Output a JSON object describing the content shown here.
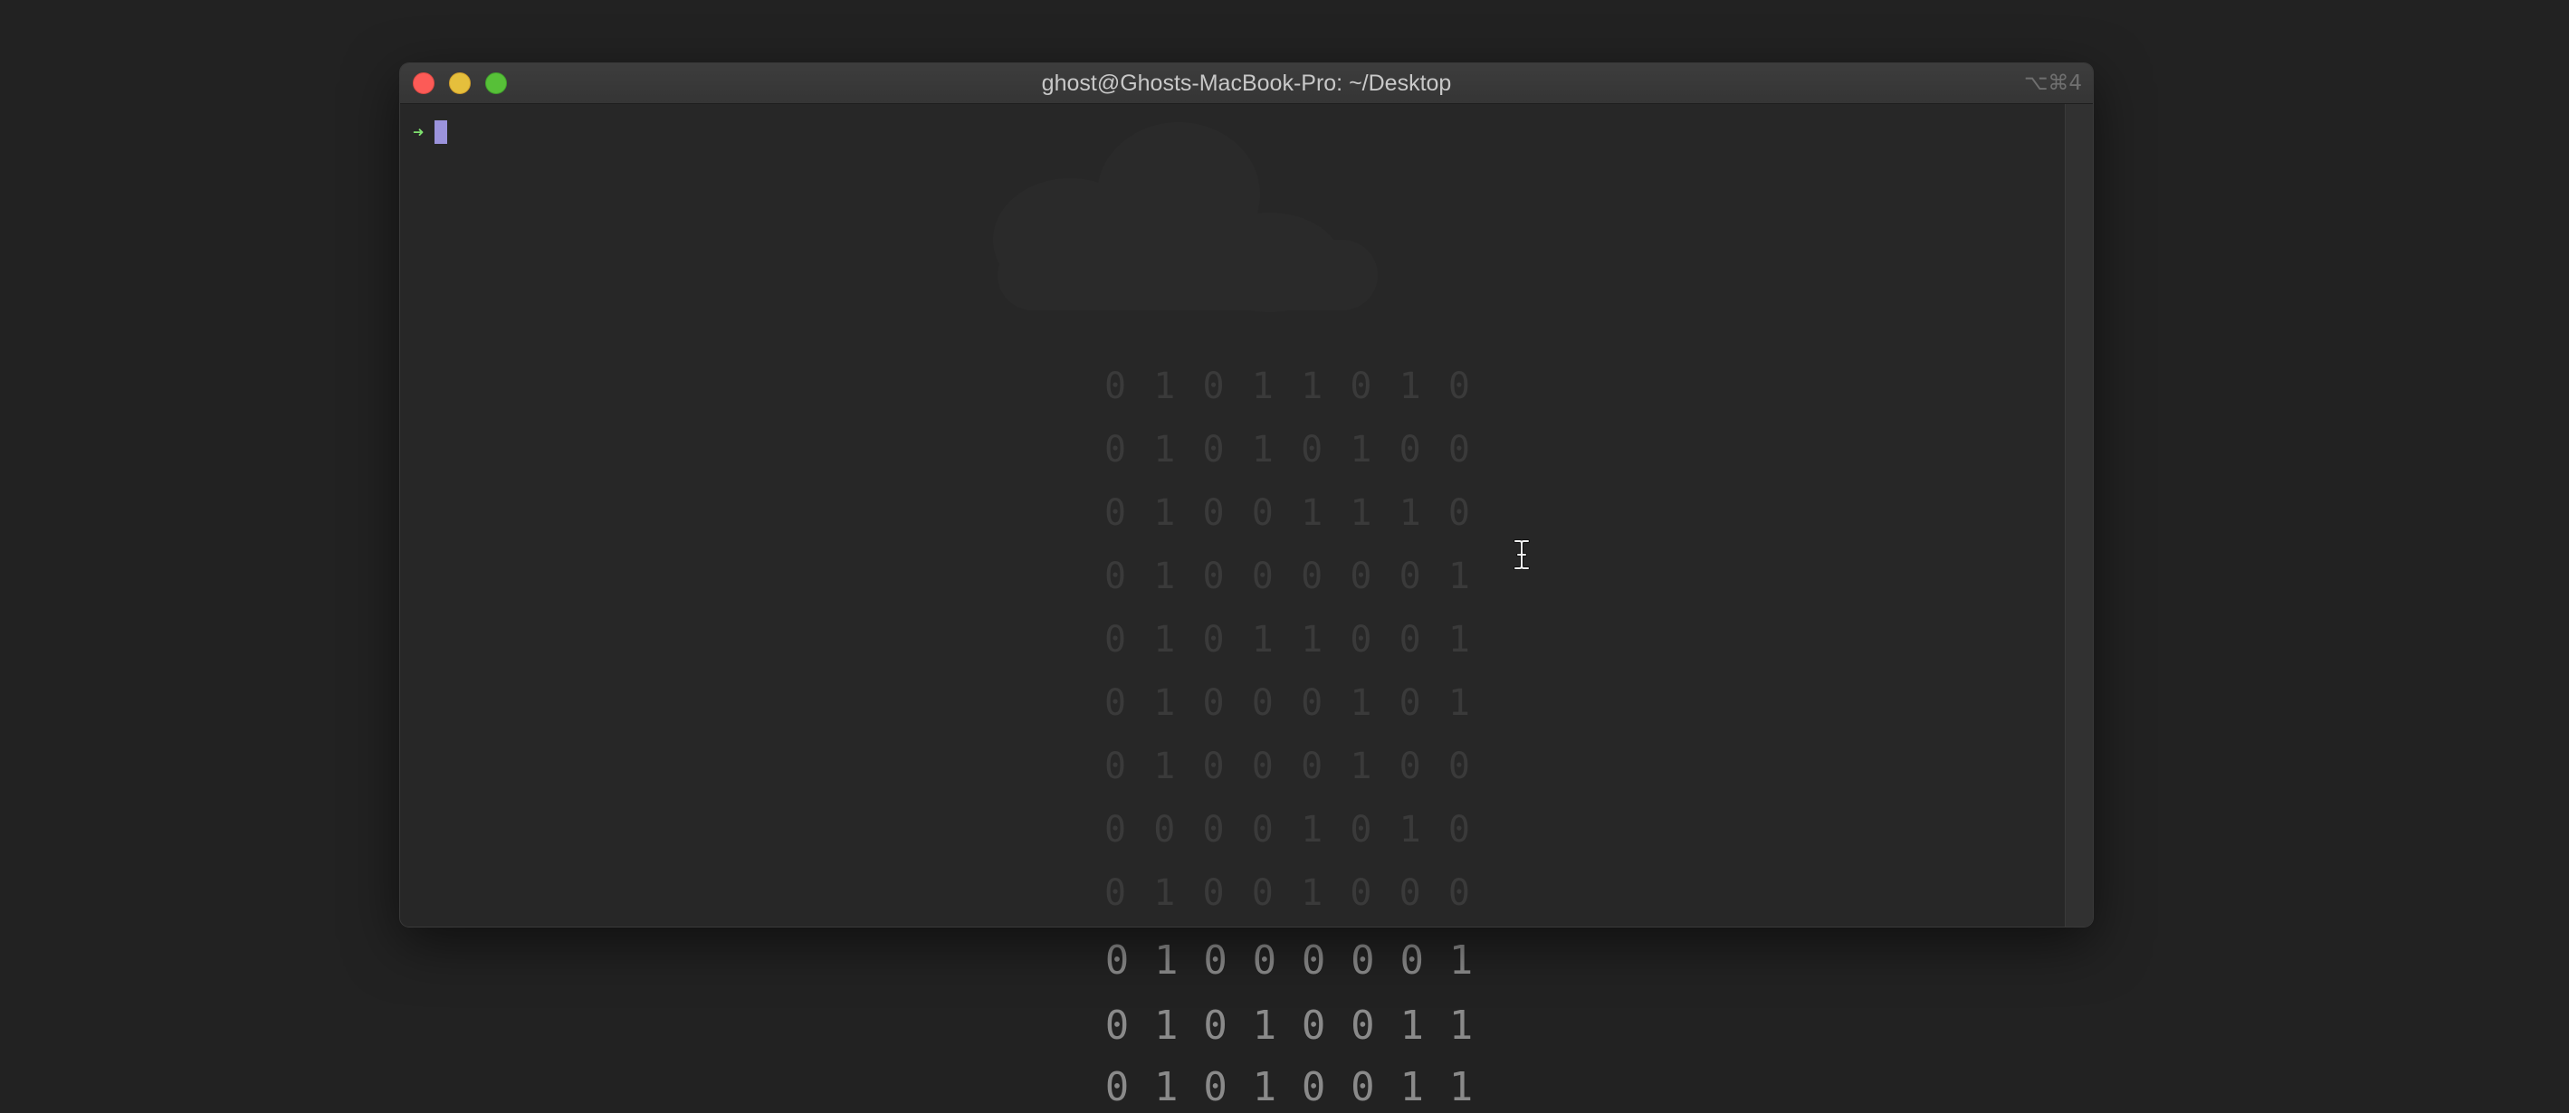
{
  "window": {
    "title": "ghost@Ghosts-MacBook-Pro: ~/Desktop",
    "tab_shortcut": "⌥⌘4",
    "controls": {
      "close_color": "#fc5b57",
      "minimize_color": "#e5bf3c",
      "zoom_color": "#57c038"
    }
  },
  "terminal": {
    "prompt_symbol": "➜",
    "prompt_color": "#7ee06e",
    "cursor_color": "#9b93dc",
    "background": "#282828"
  },
  "wallpaper": {
    "description_icon": "cloud-binary-rain",
    "visible_rows": [
      "0 1 0 0 0 0 0 1",
      "0 1 0 1 0 0 1 1",
      "0 1 0 1 0 0 1 1"
    ],
    "ghost_rows": [
      "0 1 0 1 1 0 1 0",
      "0 1 0 1 0 1 0 0",
      "0 1 0 0 1 1 1 0",
      "0 1 0 0 0 0 0 1",
      "0 1 0 1 1 0 0 1",
      "0 1 0 0 0 1 0 1",
      "0 1 0 0 0 1 0 0",
      "0 0 0 0 1 0 1 0",
      "0 1 0 0 1 0 0 0"
    ]
  },
  "pointer": {
    "icon": "ibeam-cursor-icon"
  }
}
